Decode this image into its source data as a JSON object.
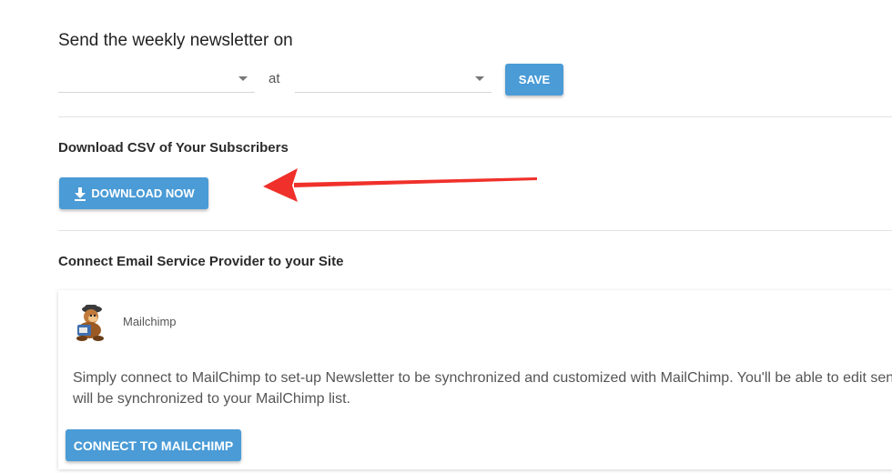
{
  "newsletter": {
    "heading": "Send the weekly newsletter on",
    "day_value": "",
    "at_label": "at",
    "time_value": "",
    "save_label": "SAVE"
  },
  "download": {
    "title": "Download CSV of Your Subscribers",
    "button_label": "DOWNLOAD NOW"
  },
  "connect": {
    "title": "Connect Email Service Provider to your Site",
    "provider": {
      "name": "Mailchimp",
      "description_line1": "Simply connect to MailChimp to set-up Newsletter to be synchronized and customized with MailChimp. You'll be able to edit send t",
      "description_line2": "will be synchronized to your MailChimp list.",
      "button_label": "CONNECT TO MAILCHIMP"
    }
  },
  "icons": {
    "dropdown": "chevron-down-icon",
    "download": "download-icon",
    "arrow": "red-arrow-annotation",
    "logo": "mailchimp-logo"
  },
  "colors": {
    "button": "#4a9bd6",
    "annotation": "#f0302a"
  }
}
